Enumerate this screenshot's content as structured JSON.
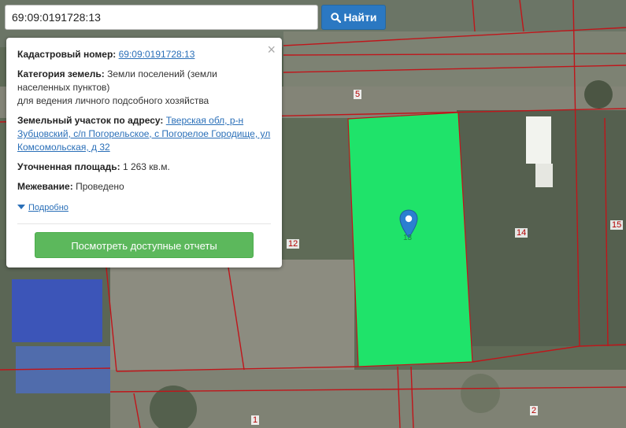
{
  "search": {
    "value": "69:09:0191728:13"
  },
  "find_button": {
    "label": "Найти",
    "icon": "search-icon"
  },
  "popup": {
    "close_label": "×",
    "cadastral": {
      "label": "Кадастровый номер:",
      "value": "69:09:0191728:13"
    },
    "category": {
      "label": "Категория земель:",
      "value": "Земли поселений (земли населенных пунктов)",
      "use": "для ведения личного подсобного хозяйства"
    },
    "address": {
      "label": "Земельный участок по адресу:",
      "value": "Тверская обл, р-н Зубцовский, с/п Погорельское, с Погорелое Городище, ул Комсомольская, д 32"
    },
    "area": {
      "label": "Уточненная площадь:",
      "value": "1 263 кв.м."
    },
    "survey": {
      "label": "Межевание:",
      "value": "Проведено"
    },
    "details_label": "Подробно",
    "reports_button": "Посмотреть доступные отчеты"
  },
  "map": {
    "plot_numbers": [
      "5",
      "12",
      "14",
      "15",
      "1",
      "2"
    ],
    "marker_label": "13",
    "highlight_color": "#1fe36a",
    "boundary_color": "#c0151a"
  }
}
